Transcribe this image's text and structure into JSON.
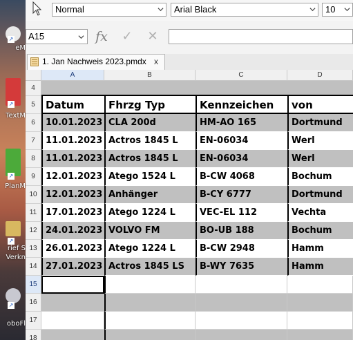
{
  "desktop": {
    "labels": [
      "eM",
      "TextM",
      "PlanM",
      "rief S",
      "Verkn",
      "oboFl"
    ]
  },
  "toolbar": {
    "style_value": "Normal",
    "font_value": "Arial Black",
    "size_value": "10"
  },
  "formula_bar": {
    "cell_ref": "A15",
    "fx_symbol": "fx",
    "confirm_symbol": "✓",
    "cancel_symbol": "✕",
    "formula": ""
  },
  "tabs": [
    {
      "label": "1. Jan  Nachweis 2023.pmdx",
      "close": "x"
    }
  ],
  "sheet": {
    "columns": [
      "A",
      "B",
      "C",
      "D"
    ],
    "active_column": "A",
    "active_row": "15",
    "header_row": {
      "row": "5",
      "cells": [
        "Datum",
        "Fhrzg Typ",
        "Kennzeichen",
        "von"
      ]
    },
    "rows": [
      {
        "row": "4",
        "cells": [
          "",
          "",
          "",
          ""
        ]
      },
      {
        "row": "6",
        "cells": [
          "10.01.2023",
          "CLA 200d",
          "HM-AO 165",
          "Dortmund"
        ]
      },
      {
        "row": "7",
        "cells": [
          "11.01.2023",
          "Actros 1845 L",
          "EN-06034",
          "Werl"
        ]
      },
      {
        "row": "8",
        "cells": [
          "11.01.2023",
          "Actros 1845 L",
          "EN-06034",
          "Werl"
        ]
      },
      {
        "row": "9",
        "cells": [
          "12.01.2023",
          "Atego 1524 L",
          "B-CW 4068",
          "Bochum"
        ]
      },
      {
        "row": "10",
        "cells": [
          "12.01.2023",
          "Anhänger",
          "B-CY 6777",
          "Dortmund"
        ]
      },
      {
        "row": "11",
        "cells": [
          "17.01.2023",
          "Atego 1224 L",
          "VEC-EL 112",
          "Vechta"
        ]
      },
      {
        "row": "12",
        "cells": [
          "24.01.2023",
          "VOLVO FM",
          "BO-UB 188",
          "Bochum"
        ]
      },
      {
        "row": "13",
        "cells": [
          "26.01.2023",
          "Atego 1224 L",
          "B-CW 2948",
          "Hamm"
        ]
      },
      {
        "row": "14",
        "cells": [
          "27.01.2023",
          "Actros 1845 LS",
          "B-WY 7635",
          "Hamm"
        ]
      },
      {
        "row": "15",
        "cells": [
          "",
          "",
          "",
          ""
        ]
      },
      {
        "row": "16",
        "cells": [
          "",
          "",
          "",
          ""
        ]
      },
      {
        "row": "17",
        "cells": [
          "",
          "",
          "",
          ""
        ]
      },
      {
        "row": "18",
        "cells": [
          "",
          "",
          "",
          ""
        ]
      }
    ]
  },
  "colors": {
    "band_gray": "#c0c0c0",
    "header_bg": "#f0f0f0",
    "active_header_bg": "#dde8f7",
    "selection_border": "#000000"
  }
}
